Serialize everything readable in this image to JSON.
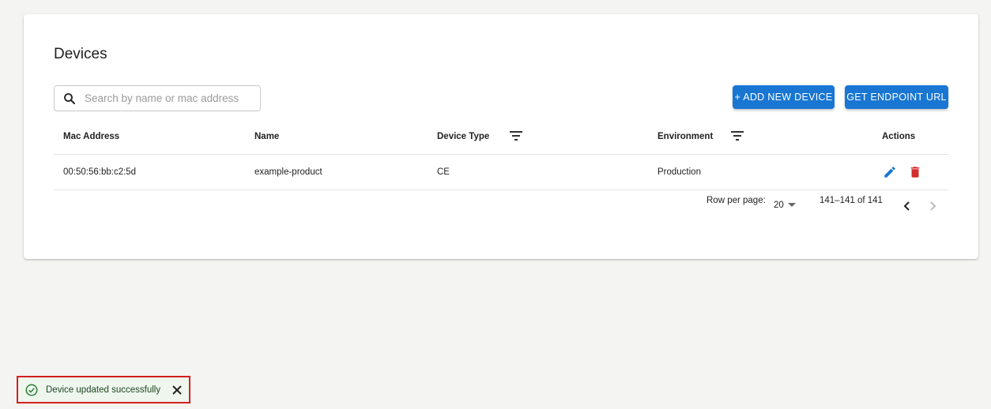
{
  "page": {
    "title": "Devices"
  },
  "search": {
    "placeholder": "Search by name or mac address",
    "value": ""
  },
  "toolbar": {
    "add_label": "+ ADD NEW DEVICE",
    "endpoint_label": "GET ENDPOINT URL",
    "accent_color": "#1976d2"
  },
  "table": {
    "columns": [
      "Mac Address",
      "Name",
      "Device Type",
      "Environment",
      "Actions"
    ],
    "rows": [
      {
        "mac": "00:50:56:bb:c2:5d",
        "name": "example-product",
        "type": "CE",
        "environment": "Production"
      }
    ]
  },
  "pagination": {
    "rows_label": "Row per page:",
    "rows_value": "20",
    "range": "141–141 of 141"
  },
  "toast": {
    "message": "Device updated successfully",
    "icon": "check-circle-icon",
    "color": "#2e7d32"
  }
}
